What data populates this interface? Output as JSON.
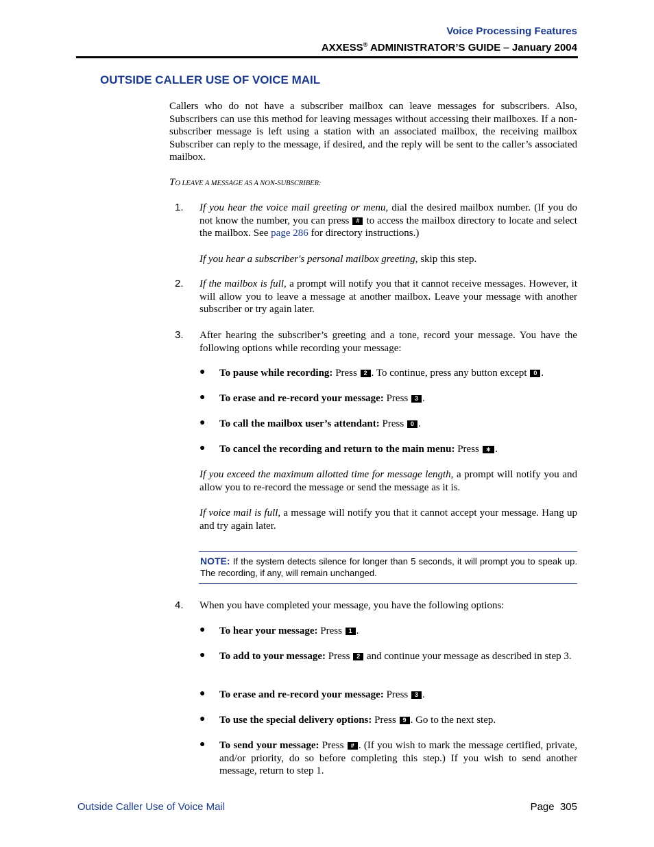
{
  "header": {
    "section": "Voice Processing Features",
    "guide_brand": "AXXESS",
    "guide_reg": "®",
    "guide_rest": " ADMINISTRATOR’S GUIDE",
    "guide_dash": " – ",
    "guide_date": "January 2004"
  },
  "section_title": "OUTSIDE CALLER USE OF VOICE MAIL",
  "intro": "Callers who do not have a subscriber mailbox can leave messages for subscribers. Also, Subscribers can use this method for leaving messages without accessing their mailboxes. If a non-subscriber message is left using a station with an associated mailbox, the receiving mailbox Subscriber can reply to the message, if desired, and the reply will be sent to the caller’s associated mailbox.",
  "procedure_title": {
    "first": "T",
    "rest": "O LEAVE A MESSAGE AS A NON-SUBSCRIBER:"
  },
  "steps": [
    {
      "number": "1.",
      "italic_lead": "If you hear the voice mail greeting or menu,",
      "text_a": " dial the desired mailbox number. (If you do not know the number, you can press ",
      "key": "#",
      "text_b": " to access the mailbox directory to locate and select the mailbox. See ",
      "link": "page 286",
      "text_c": " for directory instructions.)",
      "sub_italic": "If you hear a subscriber's personal mailbox greeting,",
      "sub_text": " skip this step."
    },
    {
      "number": "2.",
      "italic_lead": "If the mailbox is full,",
      "text": " a prompt will notify you that it cannot receive messages. However, it will allow you to leave a message at another mailbox. Leave your message with another subscriber or try again later."
    },
    {
      "number": "3.",
      "text": "After hearing the subscriber’s greeting and a tone, record your message. You have the following options while recording your message:",
      "options": [
        {
          "label": "To pause while recording:",
          "text_a": " Press ",
          "key": "2",
          "text_b": ". To continue, press any button except ",
          "key2": "0",
          "text_c": "."
        },
        {
          "label": "To erase and re-record your message:",
          "text_a": " Press ",
          "key": "3",
          "text_b": "."
        },
        {
          "label": "To call the mailbox user’s attendant:",
          "text_a": " Press ",
          "key": "0",
          "text_b": "."
        },
        {
          "label": "To cancel the recording and return to the main menu:",
          "text_a": " Press ",
          "key": "∗",
          "text_b": "."
        }
      ],
      "para1_italic": "If you exceed the maximum allotted time for message length,",
      "para1_text": " a prompt will notify you and allow you to re-record the message or send the message as it is.",
      "para2_italic": "If voice mail is full,",
      "para2_text": " a message will notify you that it cannot accept your message. Hang up and try again later."
    },
    {
      "number": "4.",
      "text": "When you have completed your message, you have the following options:",
      "options": [
        {
          "label": "To hear your message:",
          "text_a": " Press ",
          "key": "1",
          "text_b": "."
        },
        {
          "label": "To add to your message:",
          "text_a": " Press ",
          "key": "2",
          "text_b": " and continue your message as described in step 3."
        },
        {
          "label": "To erase and re-record your message:",
          "text_a": " Press ",
          "key": "3",
          "text_b": "."
        },
        {
          "label": "To use the special delivery options:",
          "text_a": " Press ",
          "key": "9",
          "text_b": ". Go to the next step."
        },
        {
          "label": "To send your message:",
          "text_a": " Press ",
          "key": "#",
          "text_b": ". (If you wish to mark the message certified, private, and/or priority, do so before completing this step.) If you wish to send another message, return to step 1."
        }
      ]
    }
  ],
  "note": {
    "label": "NOTE:",
    "text": " If the system detects silence for longer than 5 seconds, it will prompt you to speak up. The recording, if any, will remain unchanged."
  },
  "footer": {
    "left": "Outside Caller Use of Voice Mail",
    "page_label": "Page",
    "page_number": "305"
  },
  "colors": {
    "accent_blue": "#1c3a8a",
    "key_bg": "#000000"
  }
}
